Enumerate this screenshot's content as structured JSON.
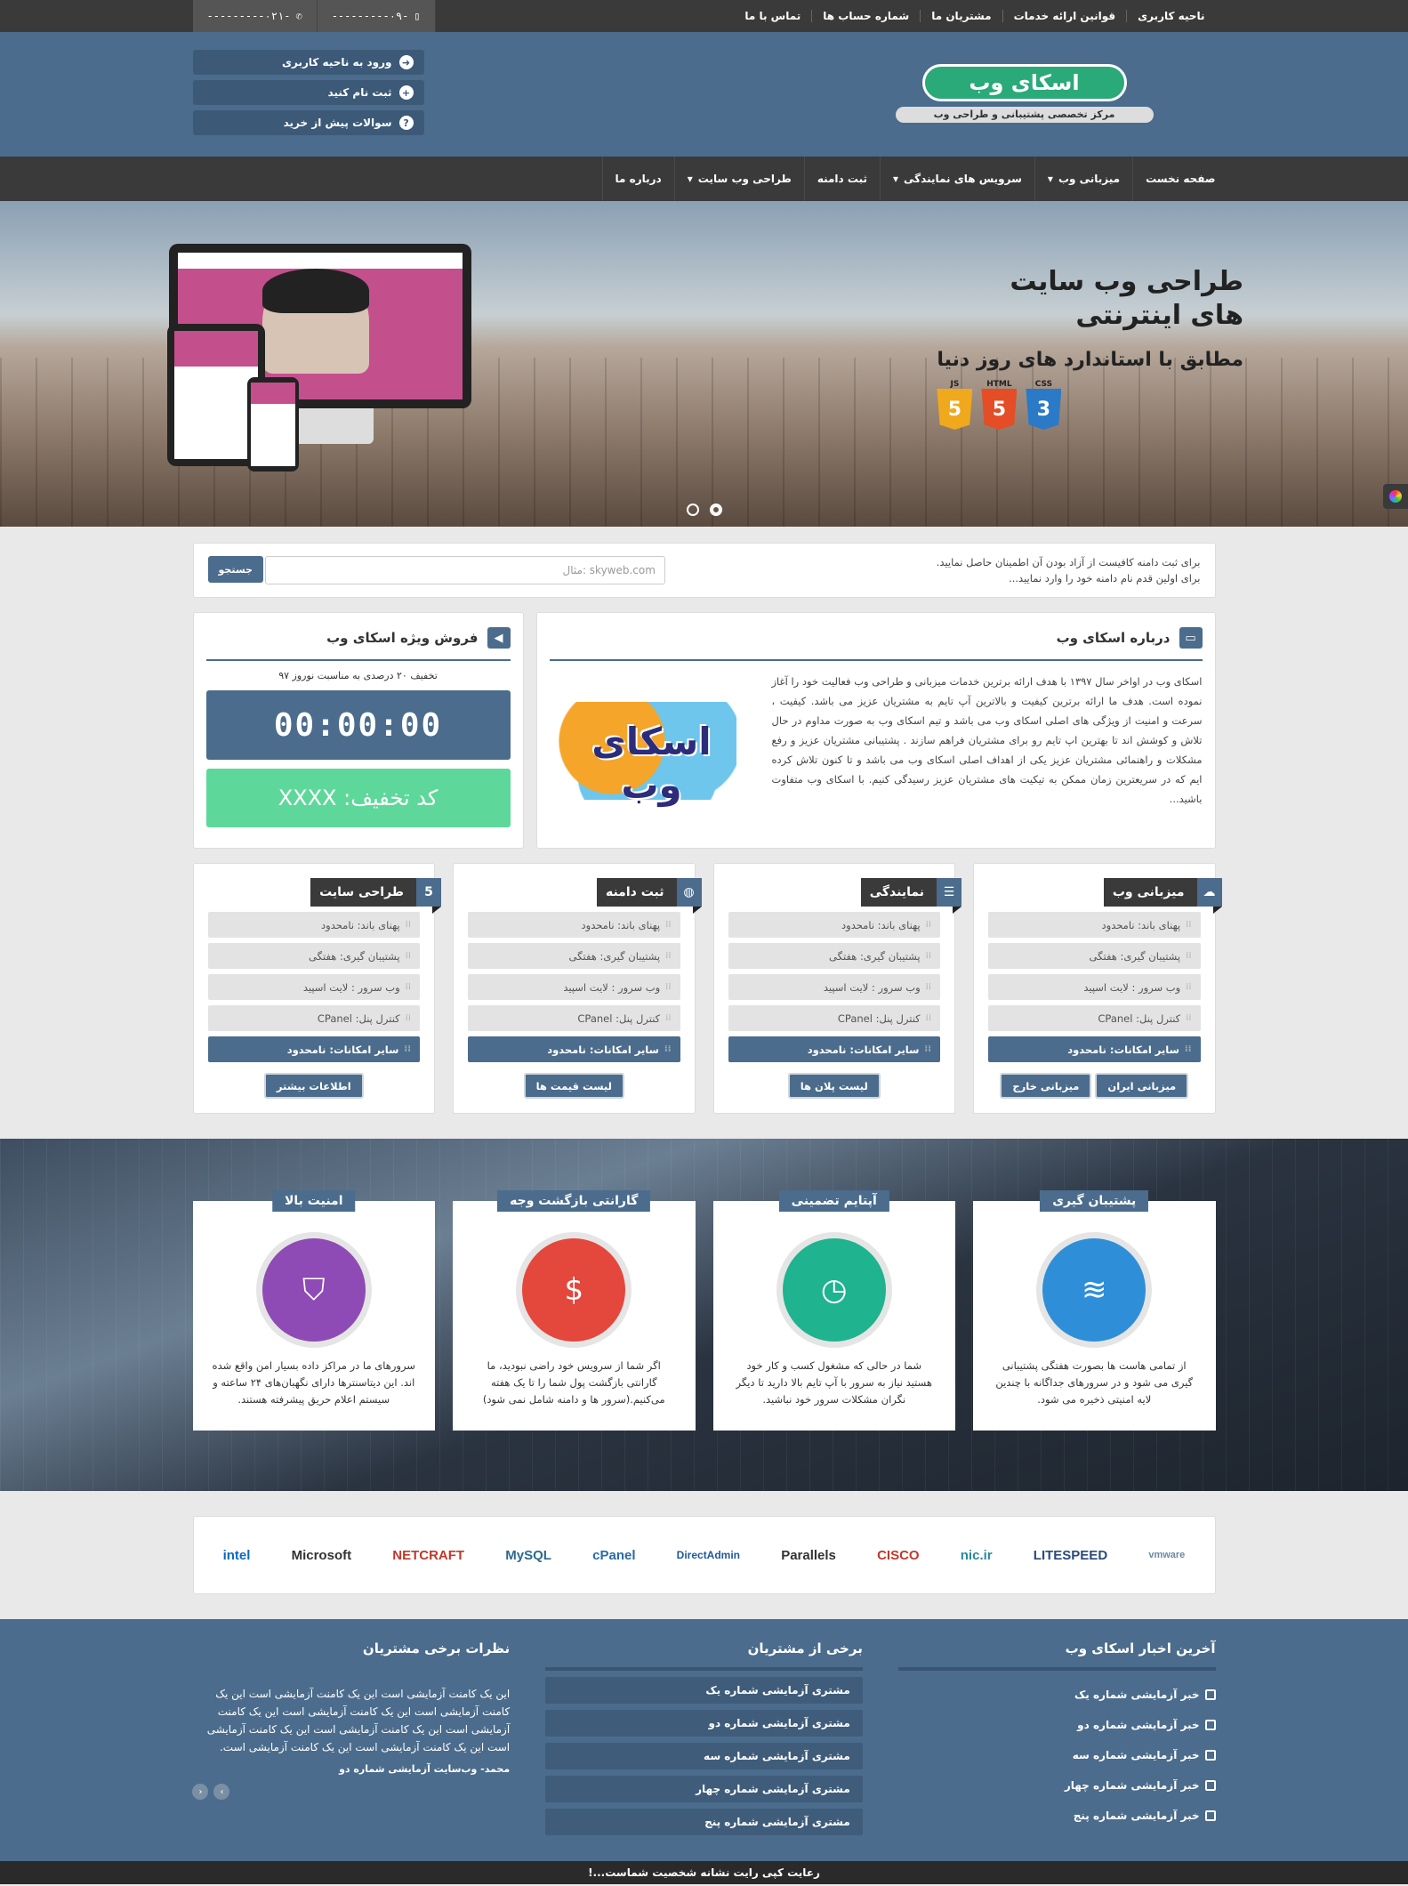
{
  "topbar": {
    "links": [
      "ناحیه کاربری",
      "قوانین ارائه خدمات",
      "مشتریان ما",
      "شماره حساب ها",
      "تماس با ما"
    ],
    "phone_mobile": "-۰۹---------",
    "phone_tel": "-۰۲۱---------"
  },
  "header": {
    "logo": "اسکای وب",
    "logo_sub": "مرکز تخصصی پشتیبانی و طراحی وب",
    "user_links": [
      "ورود به ناحیه کاربری",
      "ثبت نام کنید",
      "سوالات پیش از خرید"
    ]
  },
  "nav": {
    "items": [
      "صفحه نخست",
      "میزبانی وب",
      "سرویس های نمایندگی",
      "ثبت دامنه",
      "طراحی وب سایت",
      "درباره ما"
    ]
  },
  "slider": {
    "title": "طراحی وب سایت های اینترنتی",
    "subtitle": "مطابق با استاندارد های روز دنیا",
    "badges": [
      {
        "label": "JS",
        "glyph": "5",
        "color": "#f0a81c"
      },
      {
        "label": "HTML",
        "glyph": "5",
        "color": "#e44d26"
      },
      {
        "label": "CSS",
        "glyph": "3",
        "color": "#2a7ac8"
      }
    ]
  },
  "domain": {
    "line1": "برای ثبت دامنه کافیست از آزاد بودن آن اطمینان حاصل نمایید.",
    "line2": "برای اولین قدم نام دامنه خود را وارد نمایید...",
    "placeholder": "مثال: skyweb.com",
    "button": "جستجو"
  },
  "about": {
    "title": "درباره اسکای وب",
    "text": "اسکای وب در اواخر سال ۱۳۹۷ با هدف ارائه برترین خدمات میزبانی و طراحی وب فعالیت خود را آغاز نموده است. هدف ما ارائه برترین کیفیت و بالاترین آپ تایم به مشتریان عزیز می باشد. کیفیت ، سرعت و امنیت از ویژگی های اصلی اسکای وب می باشد و تیم اسکای وب به صورت مداوم در حال تلاش و کوشش اند تا بهترین اپ تایم رو برای مشتریان فراهم سازند . پشتیبانی مشتریان عزیز و رفع مشکلات و راهنمائی مشتریان عزیز یکی از اهداف اصلی اسکای وب می باشد و تا کنون تلاش کرده ایم که در سریعترین زمان ممکن به تیکیت های مشتریان عزیز رسیدگی کنیم. با اسکای وب متفاوت باشید...",
    "logo_text": "اسکای وب"
  },
  "sale": {
    "title": "فروش ویژه اسکای وب",
    "note": "تخفیف ۲۰ درصدی به مناسبت نوروز ۹۷",
    "countdown": "00:00:00",
    "coupon": "کد تخفیف: XXXX"
  },
  "services": [
    {
      "title": "میزبانی وب",
      "icon": "☁",
      "features": [
        "پهنای باند: نامحدود",
        "پشتیبان گیری: هفتگی",
        "وب سرور : لایت اسپید",
        "کنترل پنل: CPanel",
        "سایر امکانات: نامحدود"
      ],
      "buttons": [
        "میزبانی ایران",
        "میزبانی خارج"
      ]
    },
    {
      "title": "نمایندگی",
      "icon": "☰",
      "features": [
        "پهنای باند: نامحدود",
        "پشتیبان گیری: هفتگی",
        "وب سرور : لایت اسپید",
        "کنترل پنل: CPanel",
        "سایر امکانات: نامحدود"
      ],
      "buttons": [
        "لیست پلان ها"
      ]
    },
    {
      "title": "ثبت دامنه",
      "icon": "◍",
      "features": [
        "پهنای باند: نامحدود",
        "پشتیبان گیری: هفتگی",
        "وب سرور : لایت اسپید",
        "کنترل پنل: CPanel",
        "سایر امکانات: نامحدود"
      ],
      "buttons": [
        "لیست قیمت ها"
      ]
    },
    {
      "title": "طراحی سایت",
      "icon": "5",
      "features": [
        "پهنای باند: نامحدود",
        "پشتیبان گیری: هفتگی",
        "وب سرور : لایت اسپید",
        "کنترل پنل: CPanel",
        "سایر امکانات: نامحدود"
      ],
      "buttons": [
        "اطلاعات بیشتر"
      ]
    }
  ],
  "features": [
    {
      "title": "پشتیبان گیری",
      "color": "#2e8fd8",
      "icon": "≋",
      "text": "از تمامی هاست ها بصورت هفتگی پشتیبانی گیری می شود و در سرورهای جداگانه با چندین لایه امنیتی ذخیره می شود."
    },
    {
      "title": "آپتایم تضمینی",
      "color": "#1fb38f",
      "icon": "◷",
      "text": "شما در حالی که مشغول کسب و کار خود هستید نیاز به سرور با آپ تایم بالا دارید تا دیگر نگران مشکلات سرور خود نباشید."
    },
    {
      "title": "گارانتی بازگشت وجه",
      "color": "#e4473b",
      "icon": "$",
      "text": "اگر شما از سرویس خود راضی نبودید، ما گارانتی بازگشت پول شما را تا یک هفته می‌کنیم.(سرور ها و دامنه شامل نمی شود)"
    },
    {
      "title": "امنیت بالا",
      "color": "#8e4bb5",
      "icon": "⛉",
      "text": "سرورهای ما در مراکز داده بسیار امن واقع شده اند. این دیتاسنترها دارای نگهبان‌های ۲۴ ساعته و سیستم اعلام حریق پیشرفته هستند."
    }
  ],
  "partners": [
    "intel",
    "Microsoft",
    "NETCRAFT",
    "MySQL",
    "cPanel",
    "DirectAdmin",
    "Parallels",
    "CISCO",
    "nic.ir",
    "LITESPEED",
    "vmware"
  ],
  "footer": {
    "news_title": "آخرین اخبار اسکای وب",
    "news": [
      "خبر آزمایشی شماره یک",
      "خبر آزمایشی شماره دو",
      "خبر آزمایشی شماره سه",
      "خبر آزمایشی شماره چهار",
      "خبر آزمایشی شماره پنج"
    ],
    "clients_title": "برخی از مشتریان",
    "clients": [
      "مشتری آزمایشی شماره یک",
      "مشتری آزمایشی شماره دو",
      "مشتری آزمایشی شماره سه",
      "مشتری آزمایشی شماره چهار",
      "مشتری آزمایشی شماره پنج"
    ],
    "comments_title": "نظرات برخی مشتریان",
    "comment": "این یک کامنت آزمایشی است این یک کامنت آزمایشی است این یک کامنت آزمایشی است این یک کامنت آزمایشی است این یک کامنت آزمایشی است این یک کامنت آزمایشی است این یک کامنت آزمایشی است این یک کامنت آزمایشی است این یک کامنت آزمایشی است.",
    "comment_author": "محمد- وب‌سایت آزمایشی شماره دو",
    "copyright": "رعایت کپی رایت نشانه شخصیت شماست...!"
  }
}
